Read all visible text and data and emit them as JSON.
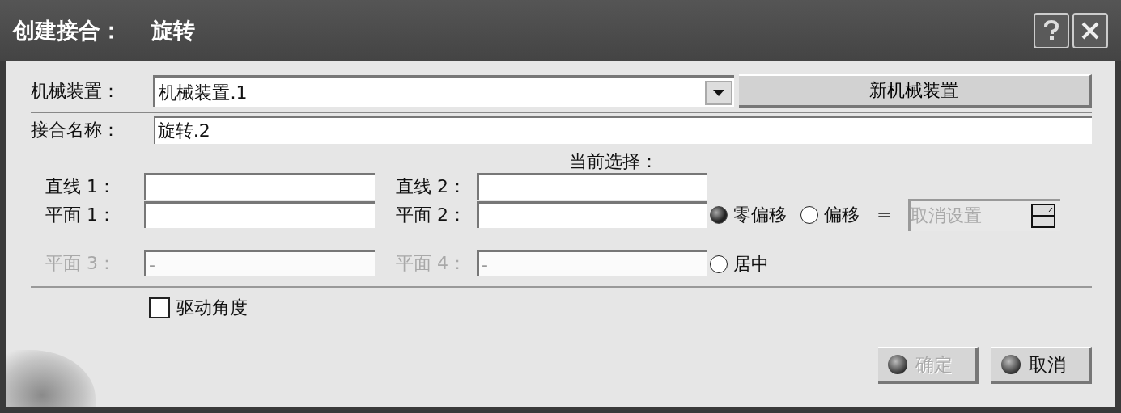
{
  "window": {
    "title_prefix": "创建接合：",
    "title_name": "旋转"
  },
  "mechanism": {
    "label": "机械装置：",
    "value": "机械装置.1",
    "button": "新机械装置"
  },
  "joint_name": {
    "label": "接合名称：",
    "value": "旋转.2"
  },
  "selection": {
    "heading": "当前选择：",
    "rows": [
      {
        "fields": [
          {
            "label": "直线 1：",
            "disabled": false
          },
          {
            "label": "直线 2：",
            "disabled": false
          }
        ]
      },
      {
        "fields": [
          {
            "label": "平面 1：",
            "disabled": false
          },
          {
            "label": "平面 2：",
            "disabled": false
          }
        ]
      },
      {
        "fields": [
          {
            "label": "平面 3：",
            "value": "-",
            "disabled": true
          },
          {
            "label": "平面 4：",
            "value": "-",
            "disabled": true
          }
        ]
      }
    ]
  },
  "options": [
    {
      "label": "零偏移",
      "selected": true
    },
    {
      "label": "偏移",
      "selected": false
    },
    {
      "label": "居中",
      "selected": false
    }
  ],
  "offset": {
    "equals": "=",
    "value": "取消设置",
    "disabled": true
  },
  "drive_angle": {
    "label": "驱动角度",
    "checked": false
  },
  "buttons": [
    {
      "label": "确定",
      "disabled": true
    },
    {
      "label": "取消",
      "disabled": false
    }
  ]
}
